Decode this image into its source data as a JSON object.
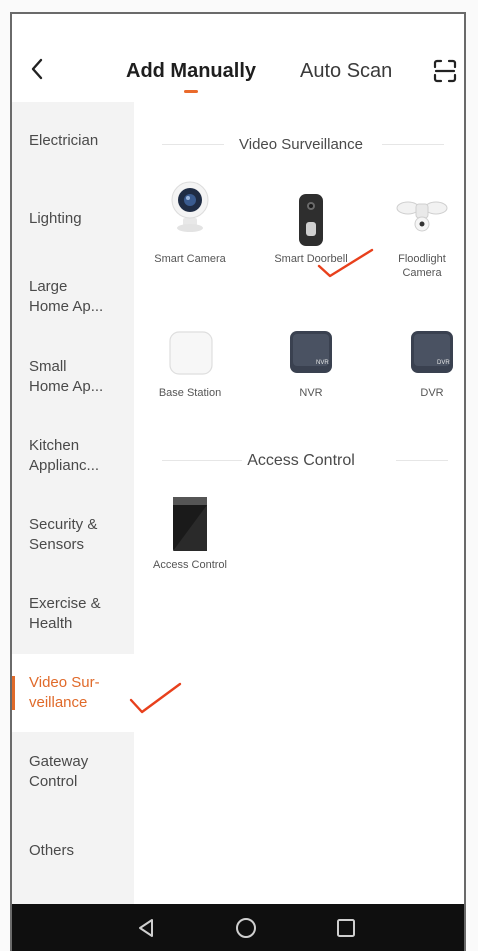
{
  "header": {
    "tabs": [
      {
        "label": "Add Manually",
        "active": true
      },
      {
        "label": "Auto Scan",
        "active": false
      }
    ]
  },
  "sidebar": {
    "items": [
      {
        "label": "Electrician"
      },
      {
        "label": "Lighting"
      },
      {
        "label": "Large\nHome Ap..."
      },
      {
        "label": "Small\nHome Ap..."
      },
      {
        "label": "Kitchen\nApplianc..."
      },
      {
        "label": "Security &\nSensors"
      },
      {
        "label": "Exercise &\nHealth"
      },
      {
        "label": "Video Sur-\nveillance",
        "active": true
      },
      {
        "label": "Gateway\nControl"
      },
      {
        "label": "Others"
      }
    ]
  },
  "sections": [
    {
      "title": "Video Surveillance",
      "devices": [
        {
          "label": "Smart Camera",
          "icon": "camera-icon"
        },
        {
          "label": "Smart Doorbell",
          "icon": "doorbell-icon"
        },
        {
          "label": "Floodlight\nCamera",
          "icon": "floodlight-icon"
        },
        {
          "label": "Base Station",
          "icon": "base-station-icon"
        },
        {
          "label": "NVR",
          "icon": "nvr-icon"
        },
        {
          "label": "DVR",
          "icon": "dvr-icon"
        }
      ]
    },
    {
      "title": "Access Control",
      "devices": [
        {
          "label": "Access Control",
          "icon": "access-control-icon"
        }
      ]
    }
  ],
  "device_badges": {
    "nvr": "NVR",
    "dvr": "DVR"
  },
  "colors": {
    "accent": "#e06a2a",
    "annotation": "#e8401c",
    "navbar": "#0f0f0f"
  },
  "navbar": {
    "icons": [
      "back-triangle-icon",
      "home-circle-icon",
      "recents-square-icon"
    ]
  }
}
